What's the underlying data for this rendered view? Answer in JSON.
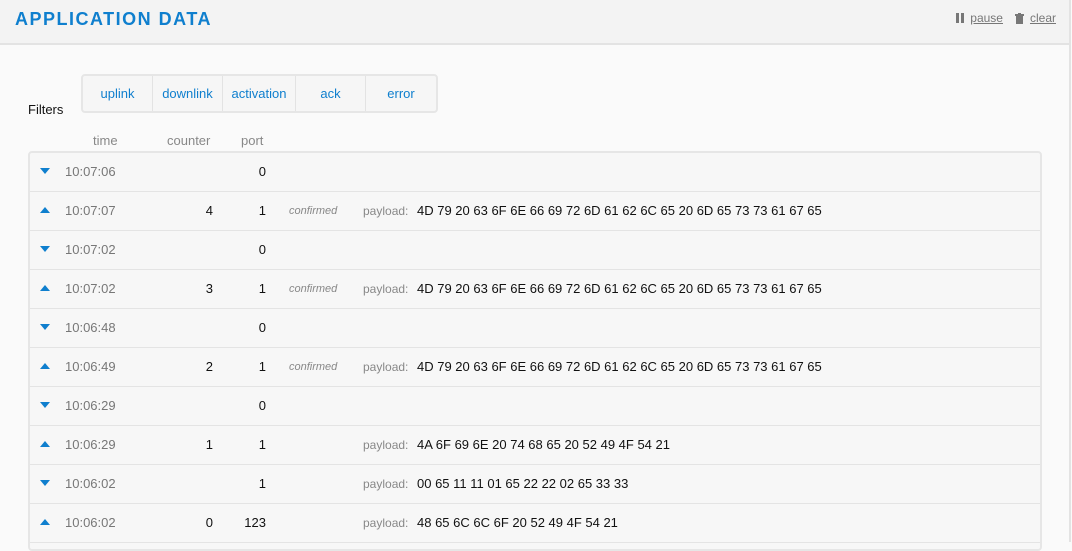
{
  "header": {
    "title": "APPLICATION DATA",
    "pause_label": "pause",
    "clear_label": "clear"
  },
  "filters": {
    "label": "Filters",
    "items": [
      "uplink",
      "downlink",
      "activation",
      "ack",
      "error"
    ]
  },
  "columns": {
    "time": "time",
    "counter": "counter",
    "port": "port"
  },
  "payload_label": "payload:",
  "rows": [
    {
      "dir": "down",
      "time": "10:07:06",
      "counter": "",
      "port": "0",
      "confirmed": "",
      "payload": ""
    },
    {
      "dir": "up",
      "time": "10:07:07",
      "counter": "4",
      "port": "1",
      "confirmed": "confirmed",
      "payload": "4D 79 20 63 6F 6E 66 69 72 6D 61 62 6C 65 20 6D 65 73 73 61 67 65"
    },
    {
      "dir": "down",
      "time": "10:07:02",
      "counter": "",
      "port": "0",
      "confirmed": "",
      "payload": ""
    },
    {
      "dir": "up",
      "time": "10:07:02",
      "counter": "3",
      "port": "1",
      "confirmed": "confirmed",
      "payload": "4D 79 20 63 6F 6E 66 69 72 6D 61 62 6C 65 20 6D 65 73 73 61 67 65"
    },
    {
      "dir": "down",
      "time": "10:06:48",
      "counter": "",
      "port": "0",
      "confirmed": "",
      "payload": ""
    },
    {
      "dir": "up",
      "time": "10:06:49",
      "counter": "2",
      "port": "1",
      "confirmed": "confirmed",
      "payload": "4D 79 20 63 6F 6E 66 69 72 6D 61 62 6C 65 20 6D 65 73 73 61 67 65"
    },
    {
      "dir": "down",
      "time": "10:06:29",
      "counter": "",
      "port": "0",
      "confirmed": "",
      "payload": ""
    },
    {
      "dir": "up",
      "time": "10:06:29",
      "counter": "1",
      "port": "1",
      "confirmed": "",
      "payload": "4A 6F 69 6E 20 74 68 65 20 52 49 4F 54 21"
    },
    {
      "dir": "down",
      "time": "10:06:02",
      "counter": "",
      "port": "1",
      "confirmed": "",
      "payload": "00 65 11 11 01 65 22 22 02 65 33 33"
    },
    {
      "dir": "up",
      "time": "10:06:02",
      "counter": "0",
      "port": "123",
      "confirmed": "",
      "payload": "48 65 6C 6C 6F 20 52 49 4F 54 21"
    }
  ]
}
